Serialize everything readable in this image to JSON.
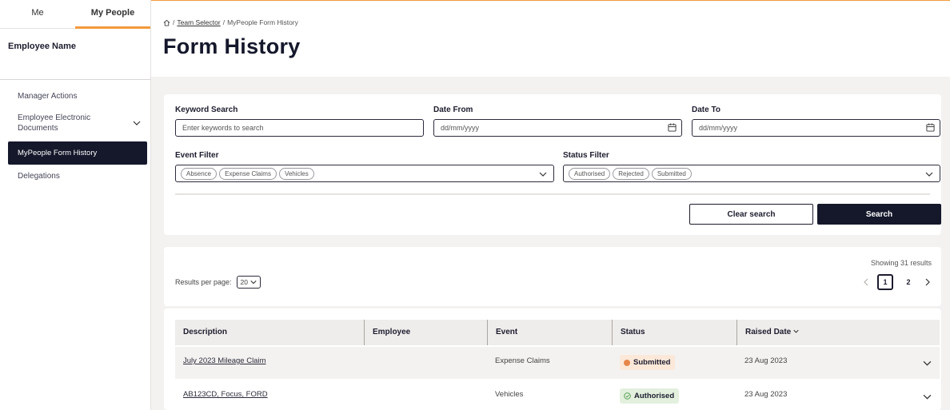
{
  "sidebar": {
    "tabs": [
      {
        "label": "Me"
      },
      {
        "label": "My People"
      }
    ],
    "employee_name": "Employee Name",
    "items": [
      {
        "label": "Manager Actions"
      },
      {
        "label": "Employee Electronic Documents"
      },
      {
        "label": "MyPeople Form History"
      },
      {
        "label": "Delegations"
      }
    ]
  },
  "breadcrumb": {
    "home_icon": "home-icon",
    "sep": "/",
    "team_selector": "Team Selector",
    "current": "MyPeople Form History"
  },
  "page_title": "Form History",
  "filters": {
    "keyword": {
      "label": "Keyword Search",
      "placeholder": "Enter keywords to search"
    },
    "date_from": {
      "label": "Date From",
      "placeholder": "dd/mm/yyyy"
    },
    "date_to": {
      "label": "Date To",
      "placeholder": "dd/mm/yyyy"
    },
    "event": {
      "label": "Event Filter",
      "chips": [
        "Absence",
        "Expense Claims",
        "Vehicles"
      ]
    },
    "status": {
      "label": "Status Filter",
      "chips": [
        "Authorised",
        "Rejected",
        "Submitted"
      ]
    },
    "clear_label": "Clear search",
    "search_label": "Search"
  },
  "results": {
    "per_page_label": "Results per page:",
    "per_page_value": "20",
    "showing": "Showing 31 results",
    "pages": [
      "1",
      "2"
    ],
    "current_page": "1"
  },
  "table": {
    "columns": [
      "Description",
      "Employee",
      "Event",
      "Status",
      "Raised Date"
    ],
    "rows": [
      {
        "description": "July 2023 Mileage Claim",
        "employee": "",
        "event": "Expense Claims",
        "status": "Submitted",
        "raised": "23 Aug 2023"
      },
      {
        "description": "AB123CD, Focus, FORD",
        "employee": "",
        "event": "Vehicles",
        "status": "Authorised",
        "raised": "23 Aug 2023"
      }
    ]
  },
  "colors": {
    "accent": "#f39a3c",
    "navy": "#15182b",
    "submitted": "#e6864a",
    "authorised": "#4f9a4a"
  }
}
